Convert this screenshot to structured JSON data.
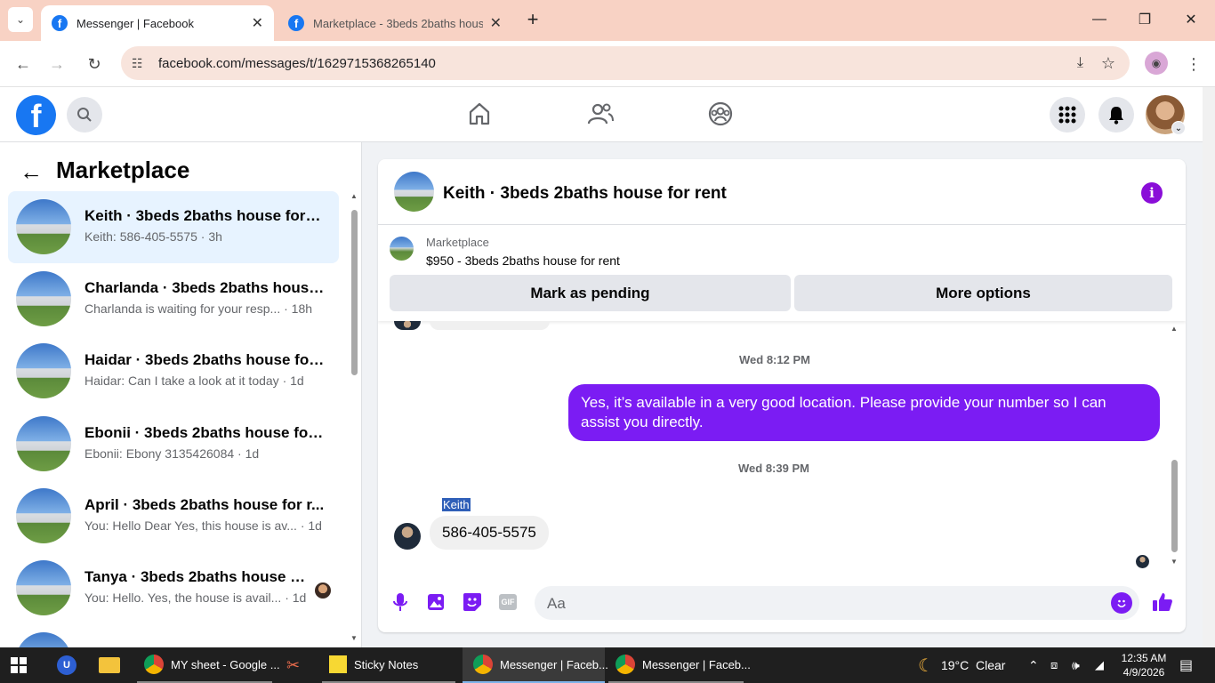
{
  "browser": {
    "tabs": [
      {
        "title": "Messenger | Facebook",
        "active": true
      },
      {
        "title": "Marketplace - 3beds 2baths house",
        "active": false
      }
    ],
    "url": "facebook.com/messages/t/1629715368265140"
  },
  "marketplace_panel": {
    "title": "Marketplace",
    "conversations": [
      {
        "name": "Keith · 3beds 2baths house for r...",
        "preview": "Keith: 586-405-5575 · 3h"
      },
      {
        "name": "Charlanda · 3beds 2baths house ...",
        "preview": "Charlanda is waiting for your resp... · 18h"
      },
      {
        "name": "Haidar · 3beds 2baths house for ...",
        "preview": "Haidar: Can I take a look at it today · 1d"
      },
      {
        "name": "Ebonii · 3beds 2baths house for ...",
        "preview": "Ebonii: Ebony 3135426084 · 1d"
      },
      {
        "name": "April · 3beds 2baths house for r...",
        "preview": "You: Hello Dear Yes, this house is av... · 1d"
      },
      {
        "name": "Tanya · 3beds 2baths house fo...",
        "preview": "You: Hello. Yes, the house is avail... · 1d"
      }
    ]
  },
  "chat": {
    "title": "Keith · 3beds 2baths house for rent",
    "listing_label": "Marketplace",
    "listing_detail": "$950 - 3beds 2baths house for rent",
    "mark_pending_label": "Mark as pending",
    "more_options_label": "More options",
    "timestamp_1": "Wed 8:12 PM",
    "outgoing_message": "Yes, it’s available in a very good location. Please provide your number so I can assist you directly.",
    "timestamp_2": "Wed 8:39 PM",
    "sender_name": "Keith",
    "incoming_message": "586-405-5575",
    "input_placeholder": "Aa"
  },
  "taskbar": {
    "items": [
      {
        "label": "MY sheet - Google ..."
      },
      {
        "label": "Sticky Notes"
      },
      {
        "label": "Messenger | Faceb..."
      },
      {
        "label": "Messenger | Faceb..."
      }
    ],
    "weather": "19°C  Clear",
    "time": "12:35 AM",
    "date": "4/9/2026"
  },
  "colors": {
    "facebook_blue": "#1877f2",
    "messenger_purple": "#7b1cf3",
    "selected_row": "#e7f3ff",
    "tabstrip": "#f8d2c4"
  }
}
